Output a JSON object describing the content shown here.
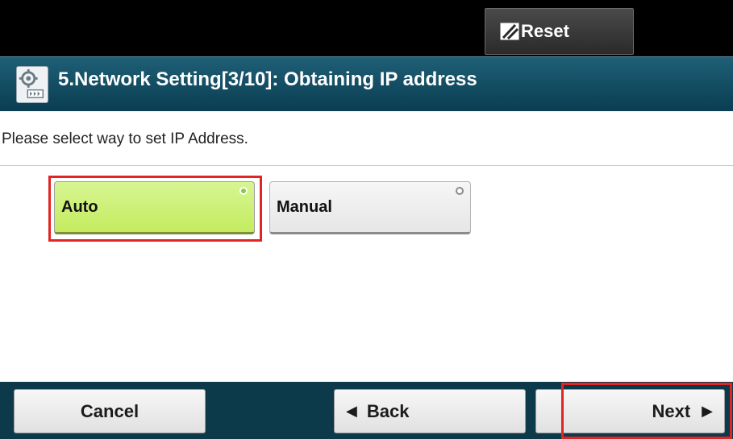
{
  "topbar": {
    "reset_label": "Reset",
    "reset_icon": "reset-icon"
  },
  "titlebar": {
    "title": "5.Network Setting[3/10]: Obtaining IP address",
    "icon": "settings-gear-icon"
  },
  "main": {
    "instruction": "Please select way to set IP Address.",
    "options": [
      {
        "label": "Auto",
        "selected": true
      },
      {
        "label": "Manual",
        "selected": false
      }
    ]
  },
  "footer": {
    "cancel_label": "Cancel",
    "back_label": "Back",
    "next_label": "Next"
  },
  "colors": {
    "selected_option": "#c9ee6c",
    "title_bar": "#0d4257",
    "highlight": "#e12424"
  }
}
